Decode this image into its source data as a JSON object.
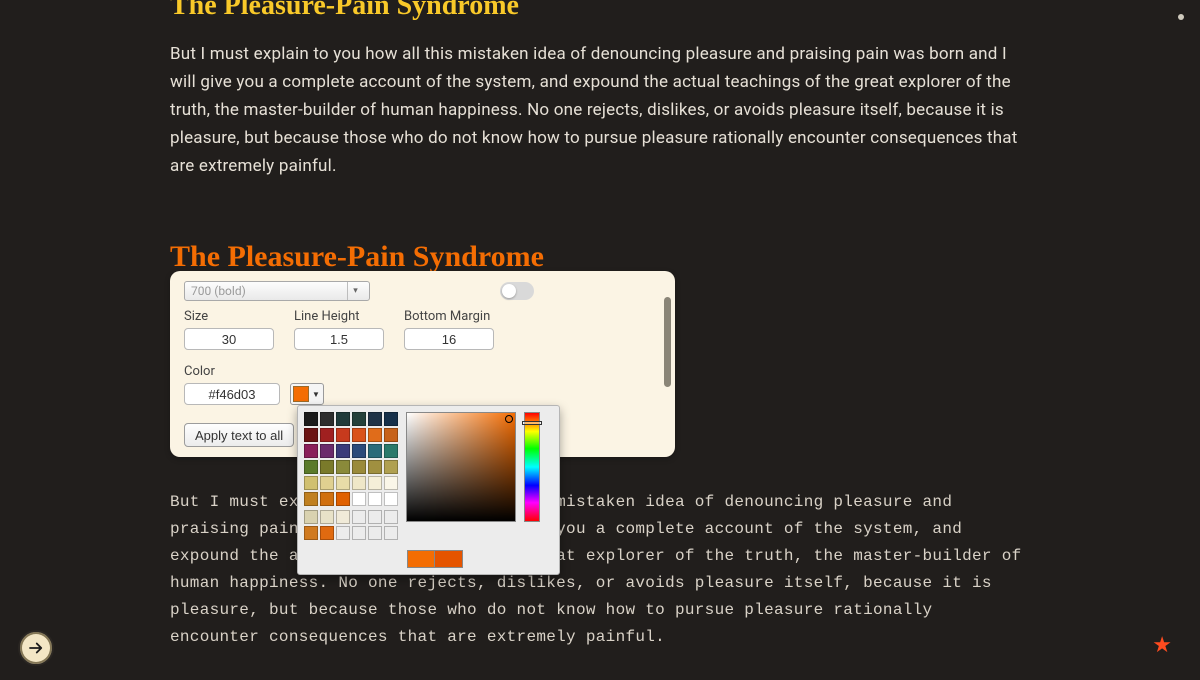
{
  "headings": {
    "first": "The Pleasure-Pain Syndrome",
    "second": "The Pleasure-Pain Syndrome"
  },
  "body": {
    "sans": "But I must explain to you how all this mistaken idea of denouncing pleasure and praising pain was born and I will give you a complete account of the system, and expound the actual teachings of the great explorer of the truth, the master-builder of human happiness. No one rejects, dislikes, or avoids pleasure itself, because it is pleasure, but because those who do not know how to pursue pleasure rationally encounter consequences that are extremely painful.",
    "mono": "But I must explain to you how all this mistaken idea of denouncing pleasure and praising pain was born and I will give you a complete account of the system, and expound the actual teachings of the great explorer of the truth, the master-builder of human happiness. No one rejects, dislikes, or avoids pleasure itself, because it is pleasure, but because those who do not know how to pursue pleasure rationally encounter consequences that are extremely painful."
  },
  "panel": {
    "weight_value": "700 (bold)",
    "size_label": "Size",
    "size_value": "30",
    "lineheight_label": "Line Height",
    "lineheight_value": "1.5",
    "margin_label": "Bottom Margin",
    "margin_value": "16",
    "color_label": "Color",
    "color_value": "#f46d03",
    "apply_label": "Apply text to all"
  },
  "picker": {
    "palette_colors": [
      "#1b1b1b",
      "#2d2d2d",
      "#1f3a3a",
      "#24403a",
      "#1f3347",
      "#16304a",
      "#6b1414",
      "#a02020",
      "#c73a1d",
      "#d9521a",
      "#e06c1a",
      "#c7621a",
      "#8a1f5a",
      "#6b2a6b",
      "#3a3a7a",
      "#2a4a7a",
      "#2a6b7a",
      "#2a7a6b",
      "#5a7a2a",
      "#7a7a2a",
      "#8a8a3a",
      "#9a8a3a",
      "#a09040",
      "#b0a050",
      "#d0c070",
      "#e0d090",
      "#e8dca8",
      "#efe7c8",
      "#f5efd8",
      "#faf6e8",
      "#c08020",
      "#d07010",
      "#e06000",
      "#ffffff",
      "#ffffff",
      "#ffffff"
    ],
    "extras_colors": [
      "#d9d2b0",
      "#e8e2c8",
      "#f0ead8",
      "",
      "",
      "",
      "#d07a20",
      "#e06a10",
      "",
      "",
      "",
      ""
    ],
    "current": "#f46d03",
    "preview": "#e55400"
  },
  "icons": {
    "arrow": "arrow-right-icon",
    "star": "star-icon"
  }
}
